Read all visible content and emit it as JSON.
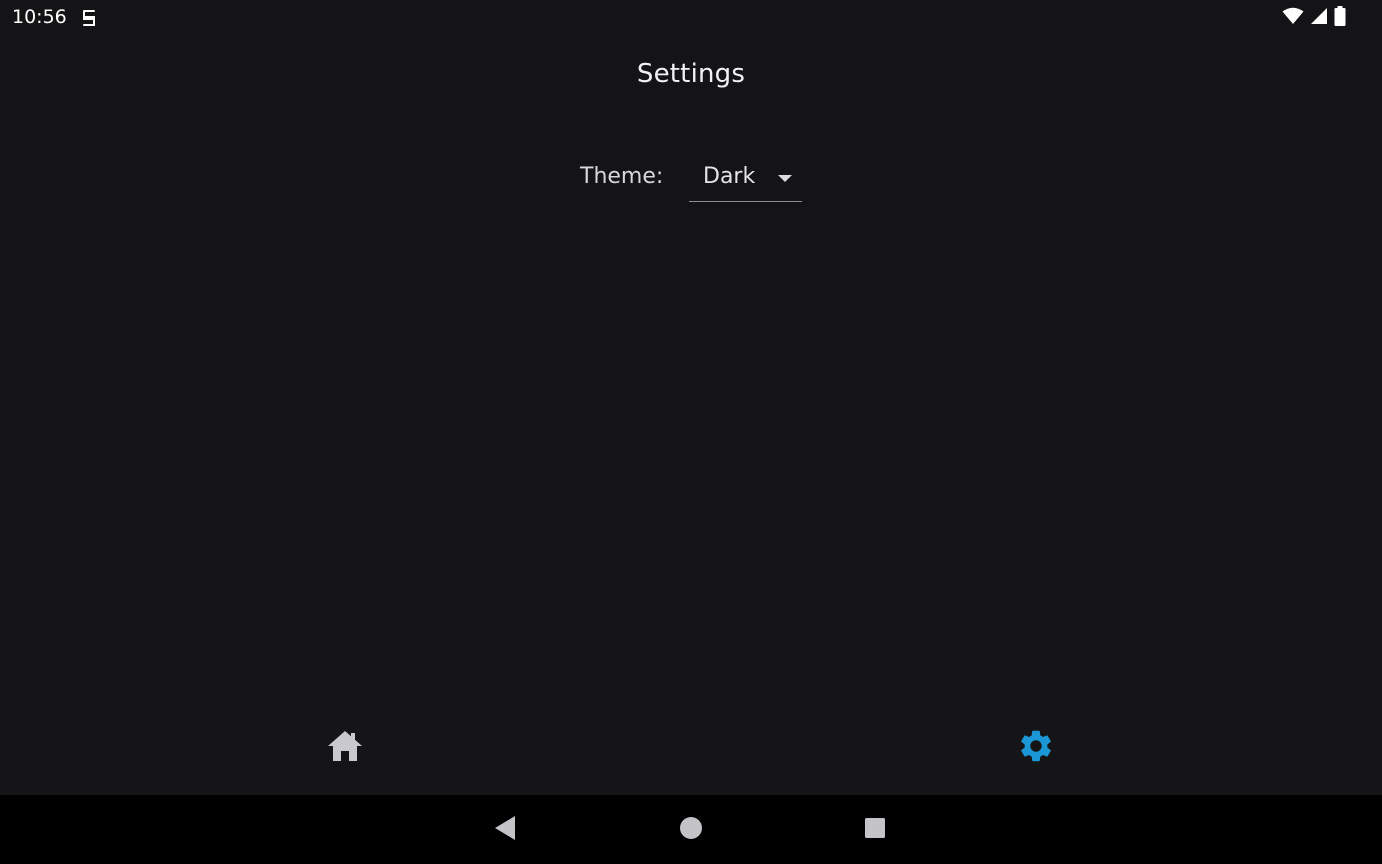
{
  "status_bar": {
    "time": "10:56",
    "icons": [
      "app-notification-icon",
      "wifi-icon",
      "cell-signal-icon",
      "battery-icon"
    ]
  },
  "page": {
    "title": "Settings"
  },
  "theme": {
    "label": "Theme:",
    "selected": "Dark"
  },
  "tabs": [
    {
      "icon": "home-icon",
      "active": false
    },
    {
      "icon": "gear-icon",
      "active": true
    }
  ],
  "colors": {
    "background": "#141316",
    "accent": "#1a97d4",
    "inactive_icon": "#c9c8ce",
    "nav_bar": "#000000"
  },
  "nav_bar": {
    "buttons": [
      "back-icon",
      "home-circle-icon",
      "recents-icon"
    ]
  }
}
